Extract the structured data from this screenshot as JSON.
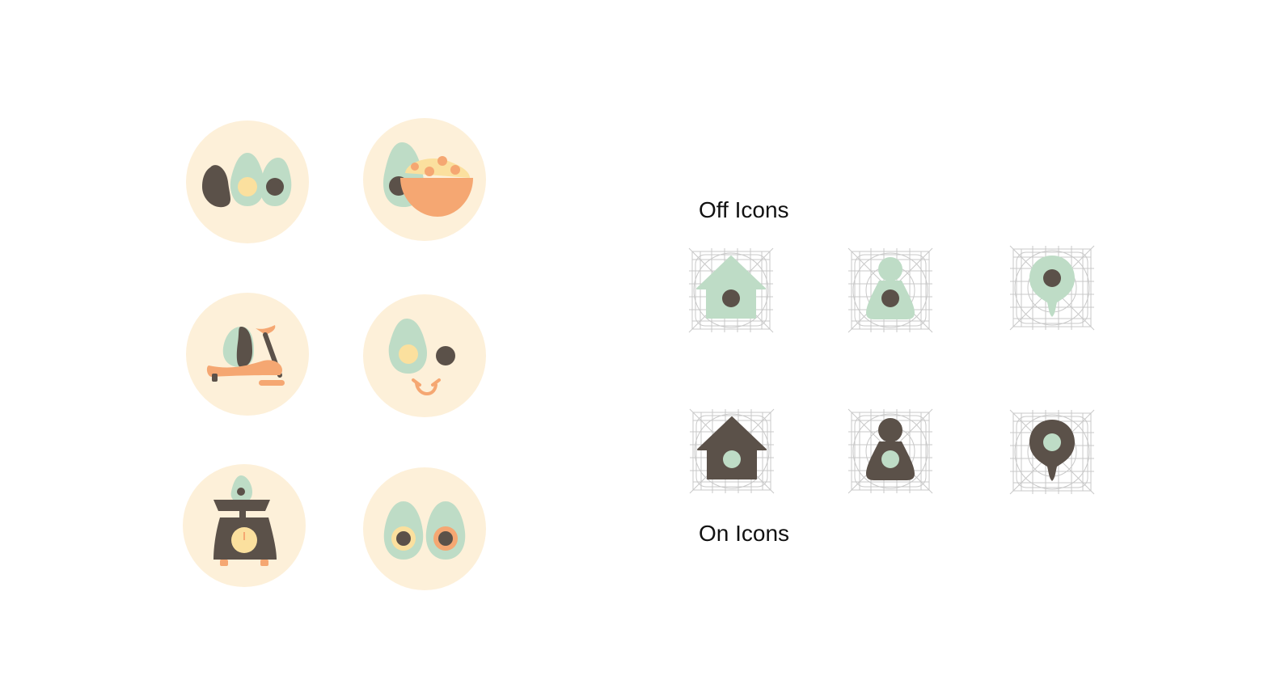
{
  "labels": {
    "off_icons": "Off Icons",
    "on_icons": "On Icons"
  },
  "colors": {
    "cream": "#FDF0D9",
    "mint": "#BEDCC6",
    "dark": "#5B5149",
    "yolk": "#FBE09E",
    "orange": "#F5A772",
    "grid": "#C9C9C9"
  },
  "illustrations": [
    "avocado-trio-icon",
    "avocado-salad-bowl-icon",
    "avocado-exercise-bike-icon",
    "avocado-smiley-icon",
    "avocado-kitchen-scale-icon",
    "avocado-pair-icon"
  ],
  "nav_icons": {
    "off": [
      "home-icon",
      "profile-icon",
      "location-pin-icon"
    ],
    "on": [
      "home-icon",
      "profile-icon",
      "location-pin-icon"
    ]
  }
}
